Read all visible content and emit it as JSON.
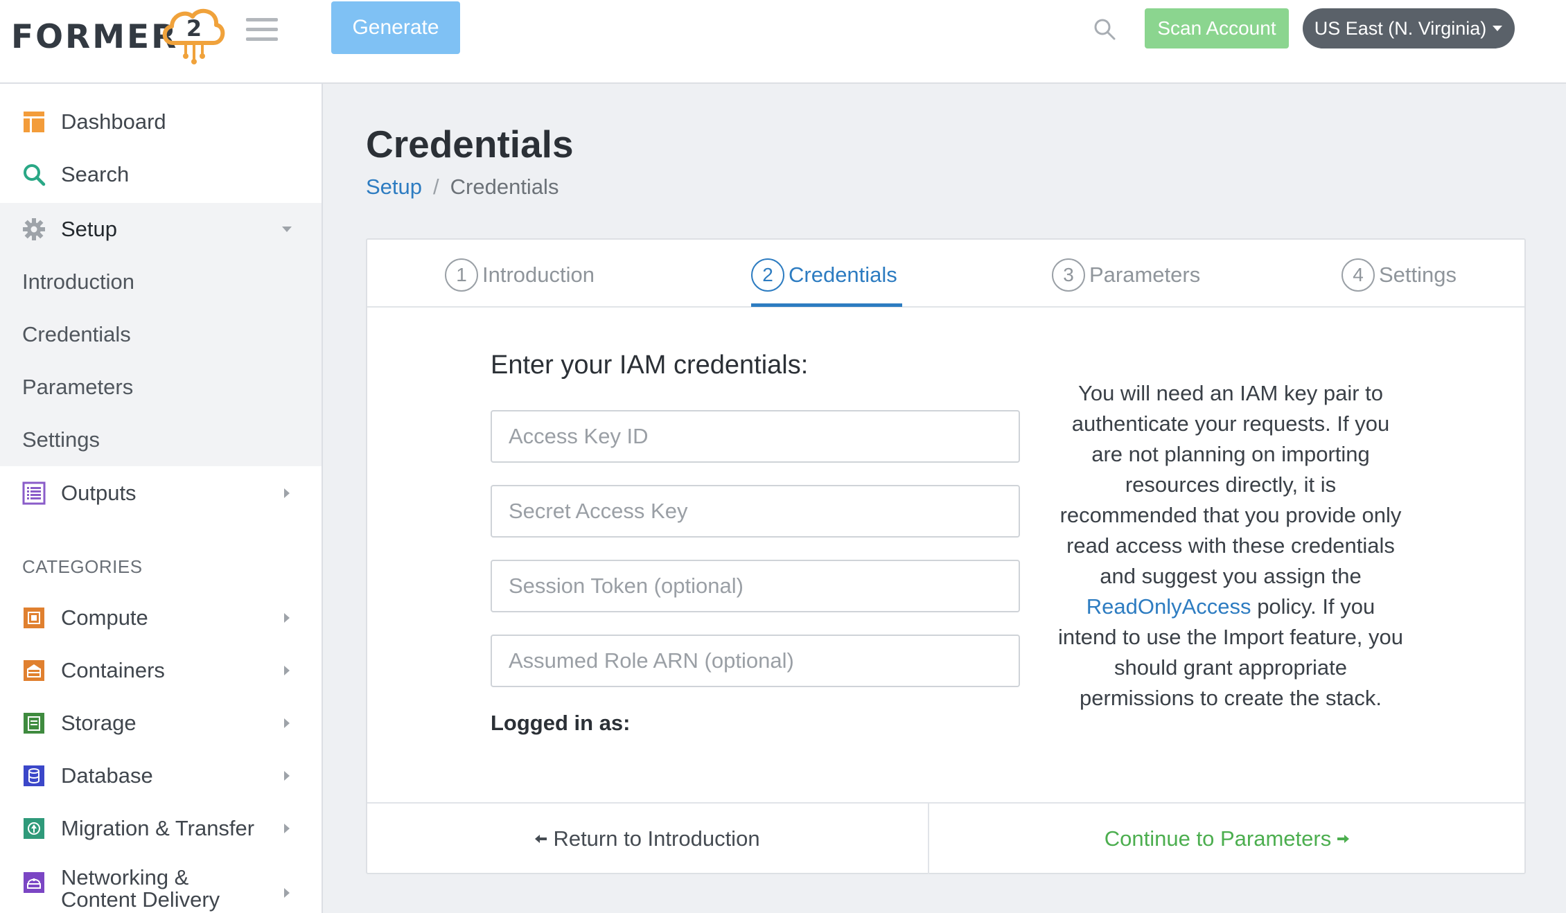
{
  "app": {
    "logo_text": "FORMER",
    "logo_badge": "2"
  },
  "header": {
    "generate_label": "Generate",
    "scan_label": "Scan Account",
    "region_label": "US East (N. Virginia)",
    "colors": {
      "generate": "#7fc1f4",
      "scan": "#8bd58f",
      "region": "#5a6169"
    }
  },
  "sidebar": {
    "dashboard": "Dashboard",
    "search": "Search",
    "setup": "Setup",
    "setup_children": [
      "Introduction",
      "Credentials",
      "Parameters",
      "Settings"
    ],
    "outputs": "Outputs",
    "categories_heading": "CATEGORIES",
    "categories": [
      "Compute",
      "Containers",
      "Storage",
      "Database",
      "Migration & Transfer",
      "Networking &",
      "Content Delivery"
    ]
  },
  "main": {
    "title": "Credentials",
    "breadcrumb": {
      "parent": "Setup",
      "separator": "/",
      "current": "Credentials"
    },
    "tabs": [
      {
        "num": "1",
        "label": "Introduction"
      },
      {
        "num": "2",
        "label": "Credentials"
      },
      {
        "num": "3",
        "label": "Parameters"
      },
      {
        "num": "4",
        "label": "Settings"
      }
    ],
    "active_tab": "Credentials",
    "form": {
      "heading": "Enter your IAM credentials:",
      "access_key_placeholder": "Access Key ID",
      "secret_key_placeholder": "Secret Access Key",
      "session_token_placeholder": "Session Token (optional)",
      "role_arn_placeholder": "Assumed Role ARN (optional)",
      "logged_in_label": "Logged in as:"
    },
    "help": {
      "text_before": "You will need an IAM key pair to authenticate your requests. If you are not planning on importing resources directly, it is recommended that you provide only read access with these credentials and suggest you assign the",
      "link": "ReadOnlyAccess",
      "text_after": "policy. If you intend to use the Import feature, you should grant appropriate permissions to create the stack."
    },
    "footer": {
      "back_label": "Return to Introduction",
      "next_label": "Continue to Parameters"
    }
  }
}
